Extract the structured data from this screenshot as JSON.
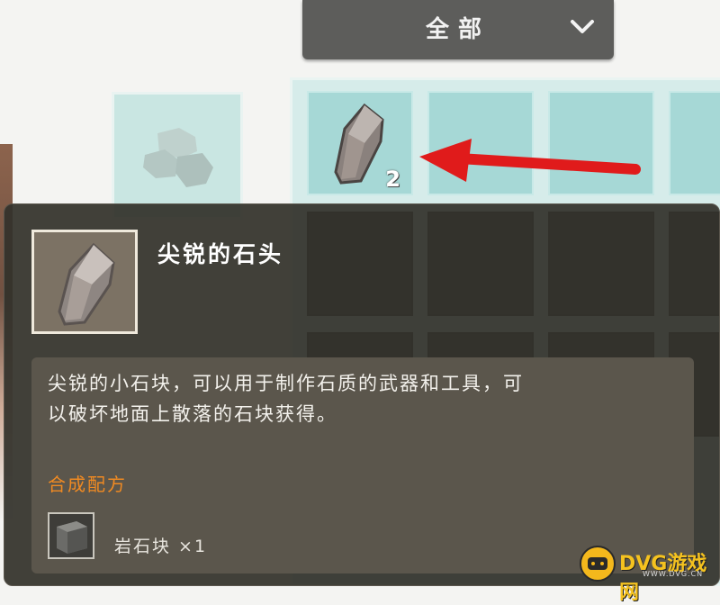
{
  "filter": {
    "label": "全部",
    "icon": "chevron-down-icon"
  },
  "equipment_slot": {
    "icon": "stone-cluster-icon"
  },
  "inventory": {
    "selected_slot": {
      "icon": "sharp-stone-icon",
      "count": "2"
    }
  },
  "tooltip": {
    "item_name": "尖锐的石头",
    "description_line1": "尖锐的小石块，可以用于制作石质的武器和工具，可",
    "description_line2": "以破坏地面上散落的石块获得。",
    "recipe_title": "合成配方",
    "ingredient": {
      "icon": "rock-block-icon",
      "label": "岩石块 ×1"
    }
  },
  "watermark": {
    "text": "DVG游戏网",
    "sub": "WWW.DVG.CN"
  },
  "colors": {
    "arrow": "#e01b1b",
    "recipe_accent": "#f08a22",
    "slot_light": "#a6d8d6",
    "slot_dark": "#37393a"
  }
}
